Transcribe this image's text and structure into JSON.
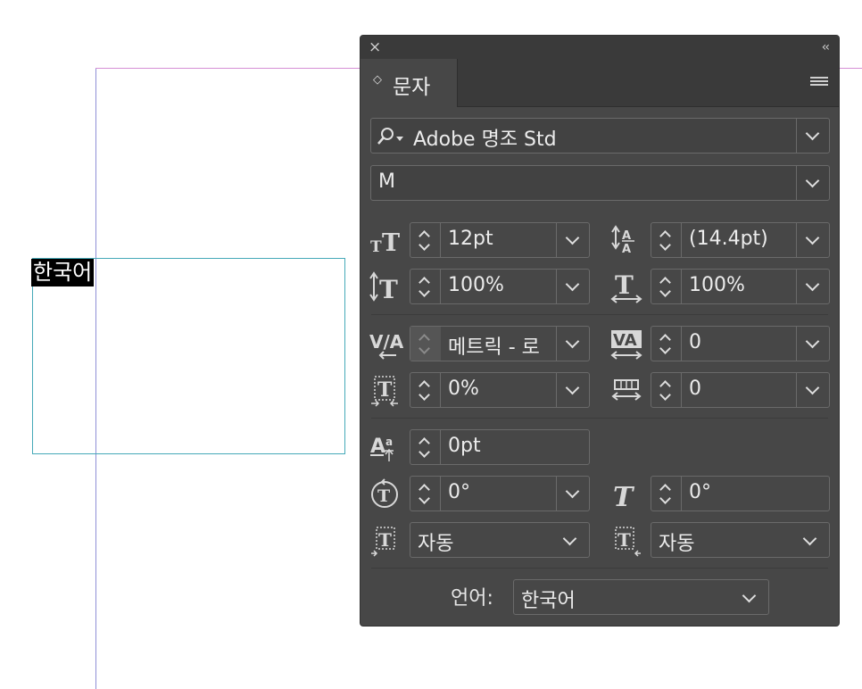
{
  "canvas": {
    "selected_text": "한국어"
  },
  "panel": {
    "close_glyph": "×",
    "collapse_glyph": "‹‹",
    "tab": {
      "arrows": "◇",
      "label": "문자"
    },
    "font_family": "Adobe 명조 Std",
    "font_style": "M",
    "font_size": "12pt",
    "leading": "(14.4pt)",
    "vertical_scale": "100%",
    "horizontal_scale": "100%",
    "kerning": "메트릭 - 로",
    "tracking": "0",
    "tsume": "0%",
    "aki": "0",
    "baseline_shift": "0pt",
    "rotation": "0°",
    "skew": "0°",
    "aki_before": "자동",
    "aki_after": "자동",
    "language_label": "언어:",
    "language": "한국어"
  }
}
